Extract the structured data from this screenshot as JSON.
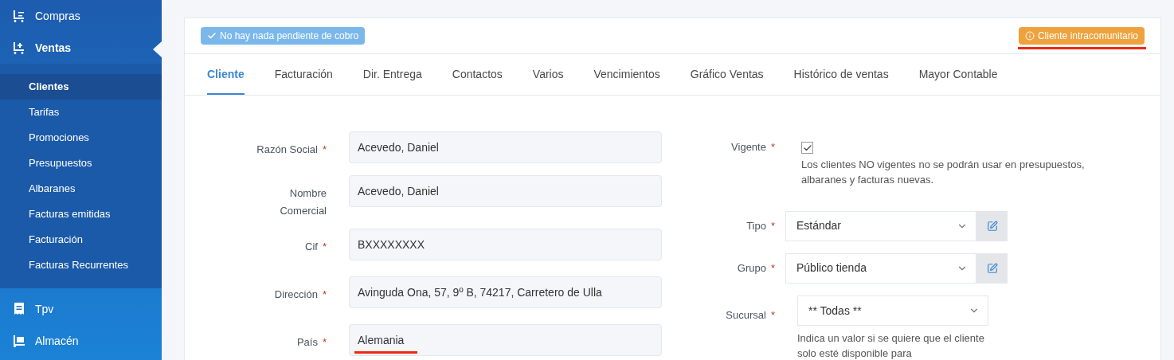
{
  "sidebar": {
    "items": [
      {
        "label": "Compras",
        "selected": false
      },
      {
        "label": "Ventas",
        "selected": true,
        "expanded": true,
        "children": [
          {
            "label": "Clientes",
            "selected": true
          },
          {
            "label": "Tarifas",
            "selected": false
          },
          {
            "label": "Promociones",
            "selected": false
          },
          {
            "label": "Presupuestos",
            "selected": false
          },
          {
            "label": "Albaranes",
            "selected": false
          },
          {
            "label": "Facturas emitidas",
            "selected": false
          },
          {
            "label": "Facturación",
            "selected": false
          },
          {
            "label": "Facturas Recurrentes",
            "selected": false
          }
        ]
      },
      {
        "label": "Tpv",
        "selected": false
      },
      {
        "label": "Almacén",
        "selected": false
      }
    ]
  },
  "status_badges": [
    {
      "kind": "success",
      "label": "No hay nada pendiente de cobro"
    },
    {
      "kind": "info",
      "label": "Cliente intracomunitario"
    }
  ],
  "tabs": [
    {
      "label": "Cliente",
      "selected": true
    },
    {
      "label": "Facturación",
      "selected": false
    },
    {
      "label": "Dir. Entrega",
      "selected": false
    },
    {
      "label": "Contactos",
      "selected": false
    },
    {
      "label": "Varios",
      "selected": false
    },
    {
      "label": "Vencimientos",
      "selected": false
    },
    {
      "label": "Gráfico Ventas",
      "selected": false
    },
    {
      "label": "Histórico de ventas",
      "selected": false
    },
    {
      "label": "Mayor Contable",
      "selected": false
    }
  ],
  "left_fields": [
    {
      "label": "Razón Social",
      "required_mark": "*",
      "value": "Acevedo, Daniel"
    },
    {
      "label": "Nombre Comercial",
      "value": "Acevedo, Daniel"
    },
    {
      "label": "Cif",
      "required_mark": "*",
      "value": "BXXXXXXXX"
    },
    {
      "label": "Dirección",
      "required_mark": "*",
      "value": "Avinguda Ona, 57, 9º B, 74217, Carretero de Ulla"
    },
    {
      "label": "País",
      "required_mark": "*",
      "value": "Alemania"
    }
  ],
  "right_fields": [
    {
      "kind": "checkbox",
      "label": "Vigente",
      "required_mark": "*",
      "checked": true,
      "help": "Los clientes NO vigentes no se podrán usar en presupuestos, albaranes y facturas nuevas."
    },
    {
      "kind": "select_edit",
      "label": "Tipo",
      "required_mark": "*",
      "value": "Estándar"
    },
    {
      "kind": "select_edit",
      "label": "Grupo",
      "required_mark": "*",
      "value": "Público tienda"
    },
    {
      "kind": "select",
      "label": "Sucursal",
      "required_mark": "*",
      "value": "** Todas **",
      "help": "Indica un valor si se quiere que el cliente solo esté disponible para"
    }
  ]
}
